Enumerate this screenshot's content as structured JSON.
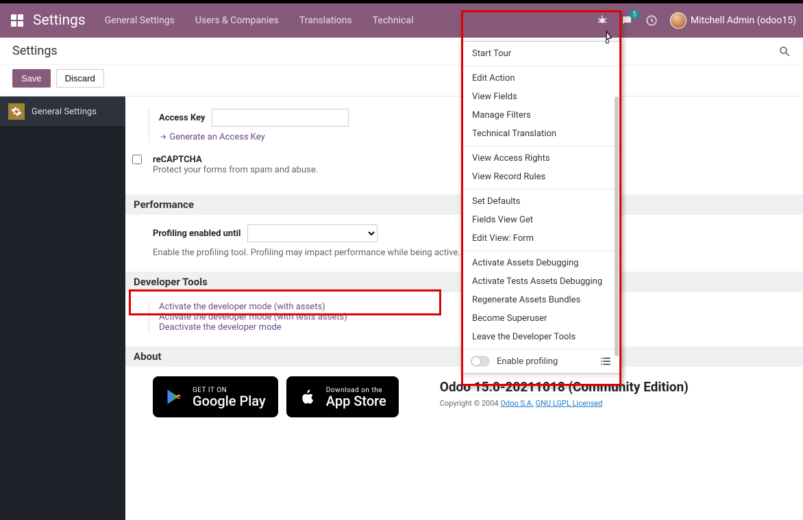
{
  "navbar": {
    "brand": "Settings",
    "menu": [
      "General Settings",
      "Users & Companies",
      "Translations",
      "Technical"
    ],
    "messages_badge": "5",
    "user": "Mitchell Admin (odoo15)"
  },
  "crumb": "Settings",
  "buttons": {
    "save": "Save",
    "discard": "Discard"
  },
  "sidebar": {
    "label": "General Settings"
  },
  "access": {
    "label": "Access Key",
    "generate": "Generate an Access Key"
  },
  "recaptcha": {
    "title": "reCAPTCHA",
    "help": "Protect your forms from spam and abuse."
  },
  "performance": {
    "header": "Performance",
    "profiling_label": "Profiling enabled until",
    "help": "Enable the profiling tool. Profiling may impact performance while being active."
  },
  "devtools": {
    "header": "Developer Tools",
    "links": [
      "Activate the developer mode (with assets)",
      "Activate the developer mode (with tests assets)",
      "Deactivate the developer mode"
    ]
  },
  "about": {
    "header": "About",
    "google_small": "GET IT ON",
    "google_big": "Google Play",
    "apple_small": "Download on the",
    "apple_big": "App Store",
    "version": "Odoo 15.0-20211018 (Community Edition)",
    "copyright_prefix": "Copyright © 2004 ",
    "link1": "Odoo S.A.",
    "link2": "GNU LGPL Licensed"
  },
  "dropdown": {
    "groups": [
      [
        "Start Tour"
      ],
      [
        "Edit Action",
        "View Fields",
        "Manage Filters",
        "Technical Translation"
      ],
      [
        "View Access Rights",
        "View Record Rules"
      ],
      [
        "Set Defaults",
        "Fields View Get",
        "Edit View: Form"
      ],
      [
        "Activate Assets Debugging",
        "Activate Tests Assets Debugging",
        "Regenerate Assets Bundles",
        "Become Superuser",
        "Leave the Developer Tools"
      ]
    ],
    "footer_label": "Enable profiling"
  }
}
